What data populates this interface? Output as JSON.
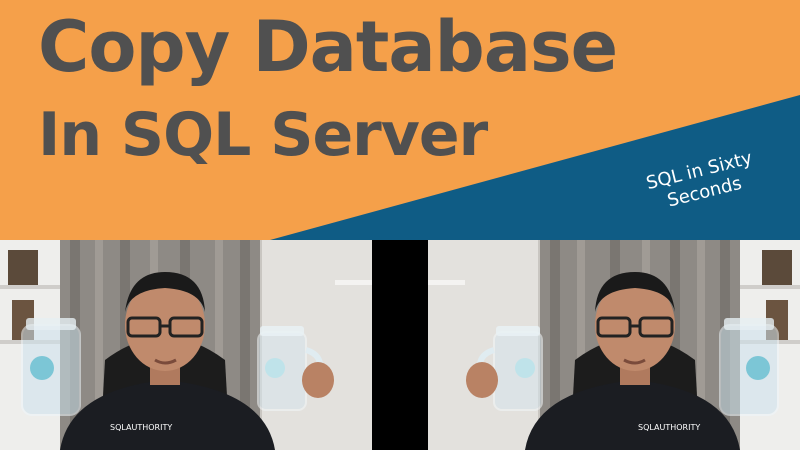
{
  "title": {
    "line1": "Copy Database",
    "line2": "In SQL Server"
  },
  "tagline": {
    "line1": "SQL in Sixty",
    "line2": "Seconds"
  },
  "colors": {
    "orange": "#F5A04A",
    "blue": "#0F5C85",
    "title_text": "#505050",
    "background": "#000000"
  },
  "photos": {
    "shirt_logo_text": "SQLAUTHORITY"
  }
}
